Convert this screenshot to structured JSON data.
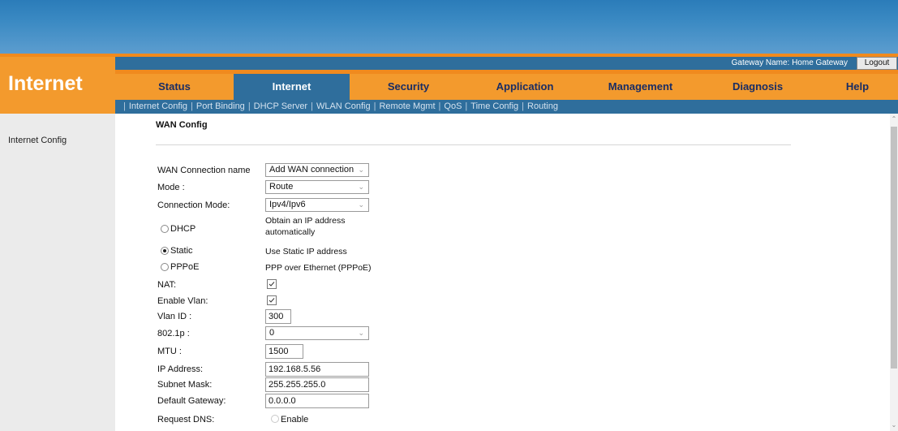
{
  "app": {
    "title": "Internet"
  },
  "header": {
    "gateway_name": "Gateway Name: Home Gateway",
    "logout_label": "Logout"
  },
  "tabs": [
    {
      "label": "Status"
    },
    {
      "label": "Internet"
    },
    {
      "label": "Security"
    },
    {
      "label": "Application"
    },
    {
      "label": "Management"
    },
    {
      "label": "Diagnosis"
    },
    {
      "label": "Help"
    }
  ],
  "active_tab": "Internet",
  "subnav": [
    {
      "label": "Internet Config"
    },
    {
      "label": "Port Binding"
    },
    {
      "label": "DHCP Server"
    },
    {
      "label": "WLAN Config"
    },
    {
      "label": "Remote Mgmt"
    },
    {
      "label": "QoS"
    },
    {
      "label": "Time Config"
    },
    {
      "label": "Routing"
    }
  ],
  "sidebar": {
    "items": [
      {
        "label": "Internet Config"
      }
    ]
  },
  "form": {
    "section_title": "WAN Config",
    "wan_connection_name": {
      "label": "WAN Connection name",
      "value": "Add WAN connection"
    },
    "mode": {
      "label": "Mode :",
      "value": "Route"
    },
    "connection_mode": {
      "label": "Connection Mode:",
      "value": "Ipv4/Ipv6"
    },
    "dhcp": {
      "label": "DHCP",
      "desc": "Obtain an IP address automatically",
      "selected": false
    },
    "static": {
      "label": "Static",
      "desc": "Use Static IP address",
      "selected": true
    },
    "pppoe": {
      "label": "PPPoE",
      "desc": "PPP over Ethernet (PPPoE)",
      "selected": false
    },
    "nat": {
      "label": "NAT:",
      "checked": true
    },
    "enable_vlan": {
      "label": "Enable Vlan:",
      "checked": true
    },
    "vlan_id": {
      "label": "Vlan ID :",
      "value": "300"
    },
    "p8021p": {
      "label": "802.1p :",
      "value": "0"
    },
    "mtu": {
      "label": "MTU :",
      "value": "1500"
    },
    "ip_address": {
      "label": "IP Address:",
      "value": "192.168.5.56"
    },
    "subnet_mask": {
      "label": "Subnet Mask:",
      "value": "255.255.255.0"
    },
    "default_gateway": {
      "label": "Default Gateway:",
      "value": "0.0.0.0"
    },
    "request_dns": {
      "label": "Request DNS:",
      "enable_label": "Enable"
    }
  },
  "colors": {
    "banner_blue": "#3b8ac3",
    "nav_blue": "#2f6e9c",
    "accent_orange": "#f39a2d",
    "tab_text": "#1a2d64"
  },
  "icons": {
    "dropdown": "chevron-down-icon",
    "checkbox": "checkmark-icon",
    "scroll_up": "arrow-up-icon",
    "scroll_down": "arrow-down-icon"
  }
}
